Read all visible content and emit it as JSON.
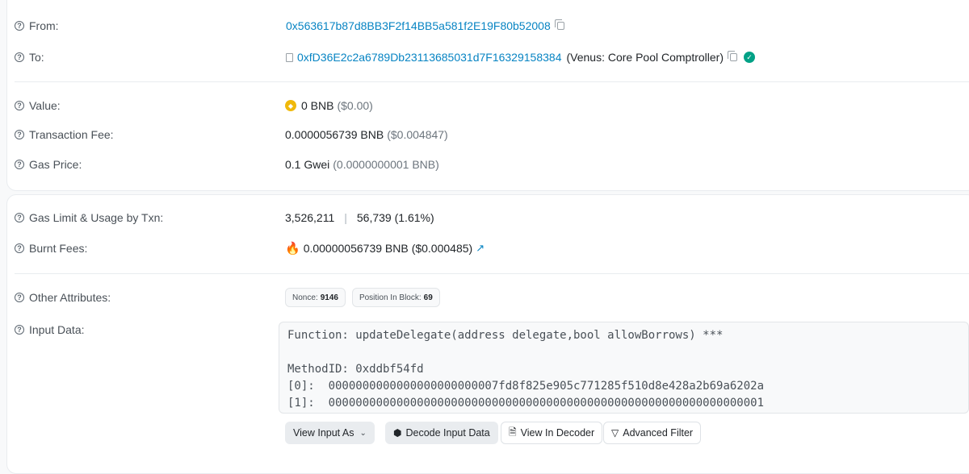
{
  "from": {
    "label": "From:",
    "address": "0x563617b87d8BB3F2f14BB5a581f2E19F80b52008"
  },
  "to": {
    "label": "To:",
    "address": "0xfD36E2c2a6789Db23113685031d7F16329158384",
    "name": "(Venus: Core Pool Comptroller)"
  },
  "value": {
    "label": "Value:",
    "amount": "0 BNB",
    "usd": "($0.00)"
  },
  "tx_fee": {
    "label": "Transaction Fee:",
    "amount": "0.0000056739 BNB",
    "usd": "($0.004847)"
  },
  "gas_price": {
    "label": "Gas Price:",
    "amount": "0.1 Gwei",
    "bnb": "(0.0000000001 BNB)"
  },
  "gas_limit": {
    "label": "Gas Limit & Usage by Txn:",
    "limit": "3,526,211",
    "separator": "|",
    "usage": "56,739 (1.61%)"
  },
  "burnt_fees": {
    "label": "Burnt Fees:",
    "amount": "0.00000056739 BNB",
    "usd": "($0.000485)"
  },
  "other_attributes": {
    "label": "Other Attributes:",
    "nonce_label": "Nonce:",
    "nonce": "9146",
    "position_label": "Position In Block:",
    "position": "69"
  },
  "input_data": {
    "label": "Input Data:",
    "lines": [
      "Function: updateDelegate(address delegate,bool allowBorrows) ***",
      "",
      "MethodID: 0xddbf54fd",
      "[0]:  0000000000000000000000007fd8f825e905c771285f510d8e428a2b69a6202a",
      "[1]:  0000000000000000000000000000000000000000000000000000000000000001"
    ]
  },
  "buttons": {
    "view_input_as": "View Input As",
    "decode_input_data": "Decode Input Data",
    "view_in_decoder": "View In Decoder",
    "advanced_filter": "Advanced Filter"
  },
  "icons": {
    "help": "question-circle-icon",
    "copy": "copy-icon",
    "contract": "contract-doc-icon",
    "verified": "check-circle-icon",
    "bnb": "bnb-coin-icon",
    "fire": "fire-icon",
    "external": "external-link-icon",
    "chevron": "chevron-down-icon",
    "decode": "cubes-icon",
    "doc": "file-icon",
    "filter": "filter-icon"
  },
  "colors": {
    "link": "#0784c3",
    "verified": "#00a186",
    "bnb": "#f0b90b"
  }
}
